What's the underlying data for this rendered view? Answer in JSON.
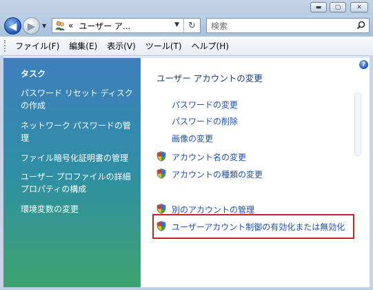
{
  "window": {
    "minimize_glyph": "▬",
    "maximize_glyph": "▢",
    "close_glyph": "✕"
  },
  "address": {
    "back_glyph": "◀",
    "forward_glyph": "▶",
    "chevrons": "«",
    "path": "ユーザー ア...",
    "refresh_glyph": "↻"
  },
  "search": {
    "placeholder": "検索",
    "icon": "search-icon"
  },
  "menu": {
    "file": "ファイル(F)",
    "edit": "編集(E)",
    "view": "表示(V)",
    "tools": "ツール(T)",
    "help": "ヘルプ(H)"
  },
  "sidebar": {
    "title": "タスク",
    "items": [
      "パスワード リセット ディスクの作成",
      "ネットワーク パスワードの管理",
      "ファイル暗号化証明書の管理",
      "ユーザー プロファイルの詳細プロパティの構成",
      "環境変数の変更"
    ]
  },
  "main": {
    "help_glyph": "?",
    "heading": "ユーザー アカウントの変更",
    "links": {
      "change_password": "パスワードの変更",
      "remove_password": "パスワードの削除",
      "change_picture": "画像の変更",
      "change_account_name": "アカウント名の変更",
      "change_account_type": "アカウントの種類の変更",
      "manage_another_account": "別のアカウントの管理",
      "toggle_uac": "ユーザーアカウント制御の有効化または無効化"
    }
  },
  "colors": {
    "link": "#1f4fa8",
    "heading": "#1a3c78",
    "highlight_border": "#cc1f1f",
    "sidebar_top": "#3f7ebd",
    "sidebar_bottom": "#3ea36f"
  }
}
